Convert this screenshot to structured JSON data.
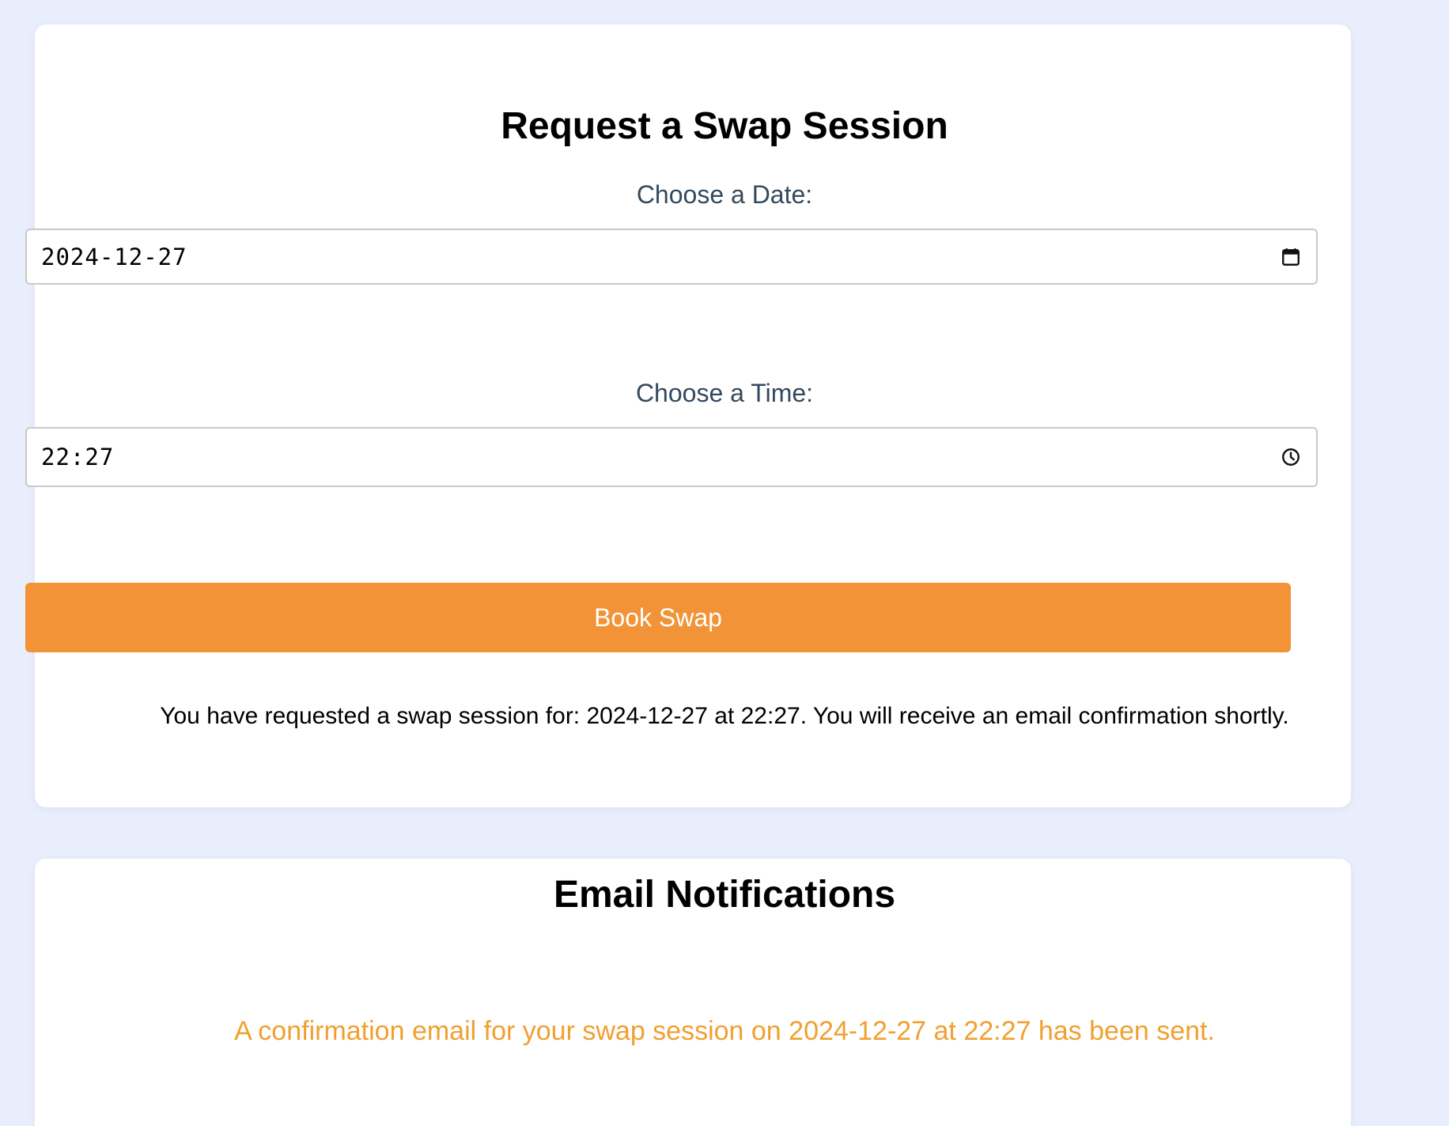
{
  "booking": {
    "title": "Request a Swap Session",
    "date_label": "Choose a Date:",
    "date_value": "2024-12-27",
    "time_label": "Choose a Time:",
    "time_value": "22:27",
    "button_label": "Book Swap",
    "confirmation_message": "You have requested a swap session for: 2024-12-27 at 22:27. You will receive an email confirmation shortly."
  },
  "email": {
    "title": "Email Notifications",
    "message": "A confirmation email for your swap session on 2024-12-27 at 22:27 has been sent."
  },
  "icons": {
    "date_icon": "calendar-icon",
    "time_icon": "clock-icon"
  },
  "colors": {
    "background": "#e8eefb",
    "card": "#ffffff",
    "accent": "#f19336",
    "email_message": "#f0a030",
    "label": "#34495e"
  }
}
